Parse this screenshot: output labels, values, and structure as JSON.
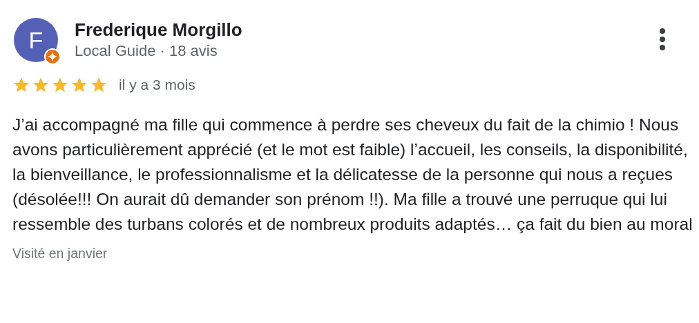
{
  "review": {
    "avatar_letter": "F",
    "author": "Frederique Morgillo",
    "local_guide": true,
    "subtitle": "Local Guide · 18 avis",
    "stars": 5,
    "time": "il y a 3 mois",
    "text": "J’ai accompagné ma fille qui commence à perdre ses cheveux du fait de la chimio ! Nous avons particulièrement apprécié (et le mot est faible) l’accueil, les conseils, la disponibilité, la bienveillance, le professionnalisme et la délicatesse de la personne qui nous a reçues (désolée!!! On aurait dû demander son prénom !!). Ma fille a trouvé une perruque qui lui ressemble des turbans colorés et de nombreux produits adaptés… ça fait du bien au moral",
    "visited": "Visité en janvier"
  }
}
